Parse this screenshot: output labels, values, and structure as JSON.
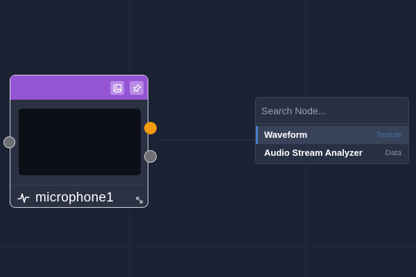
{
  "node": {
    "title": "microphone1",
    "header_color": "#9454d4",
    "header_buttons": [
      {
        "icon": "image-icon"
      },
      {
        "icon": "pin-icon"
      }
    ],
    "title_icon": "waveform-icon",
    "ports": {
      "input": {
        "color": "#6e6f73"
      },
      "outputs": [
        {
          "color": "#f29a0e"
        },
        {
          "color": "#6e6f73"
        }
      ]
    }
  },
  "search": {
    "placeholder": "Search Node...",
    "value": "",
    "results": [
      {
        "name": "Waveform",
        "type": "Texture",
        "type_color": "#3f6fa8",
        "selected": true
      },
      {
        "name": "Audio Stream Analyzer",
        "type": "Data",
        "type_color": "#8b92a2",
        "selected": false
      }
    ]
  }
}
